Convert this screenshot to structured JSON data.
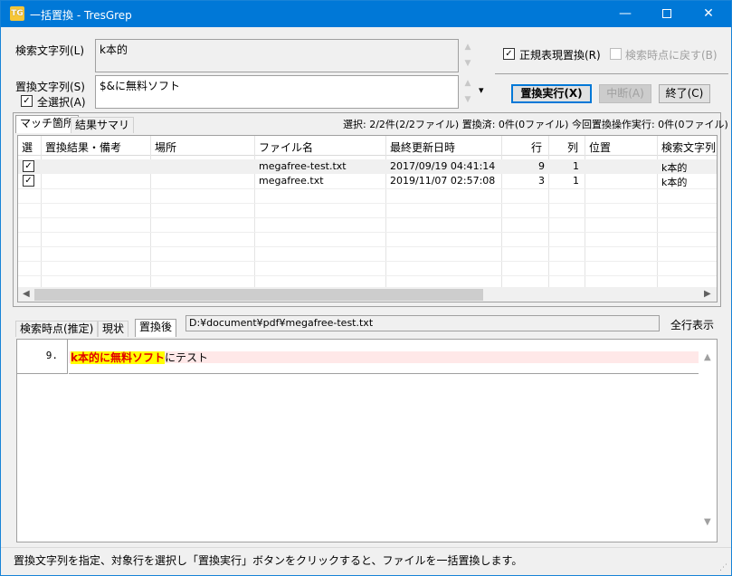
{
  "window": {
    "icon_text": "TG",
    "title": "一括置換 - TresGrep",
    "minimize_glyph": "—",
    "close_glyph": "✕"
  },
  "search": {
    "label": "検索文字列(L)",
    "value": "k本的"
  },
  "replace": {
    "label": "置換文字列(S)",
    "value": "$&に無料ソフト",
    "select_all_label": "全選択(A)",
    "select_all_checked": "✓",
    "dropdown_glyph": "▾"
  },
  "options": {
    "regex_label": "正規表現置換(R)",
    "regex_checked": "✓",
    "restore_label": "検索時点に戻す(B)"
  },
  "buttons": {
    "execute": "置換実行(X)",
    "abort": "中断(A)",
    "close": "終了(C)"
  },
  "result_tabs": [
    "マッチ箇所",
    "結果サマリ"
  ],
  "summary": "選択: 2/2件(2/2ファイル)  置換済: 0件(0ファイル)  今回置換操作実行: 0件(0ファイル)",
  "table": {
    "columns": [
      "選",
      "置換結果・備考",
      "場所",
      "ファイル名",
      "最終更新日時",
      "行",
      "列",
      "位置",
      "検索文字列"
    ],
    "rows": [
      {
        "checked": "✓",
        "note": "",
        "place": "",
        "file": "megafree-test.txt",
        "modified": "2017/09/19 04:41:14",
        "line": "9",
        "col": "1",
        "pos": "",
        "search": "k本的"
      },
      {
        "checked": "✓",
        "note": "",
        "place": "",
        "file": "megafree.txt",
        "modified": "2019/11/07 02:57:08",
        "line": "3",
        "col": "1",
        "pos": "",
        "search": "k本的"
      }
    ]
  },
  "preview_tabs": [
    "検索時点(推定)",
    "現状",
    "置換後"
  ],
  "preview_path": "D:¥document¥pdf¥megafree-test.txt",
  "show_all_lines": "全行表示",
  "preview": {
    "line_number": "9.",
    "highlight": "k本的に無料ソフト",
    "rest": "にテスト"
  },
  "status": "置換文字列を指定、対象行を選択し「置換実行」ボタンをクリックすると、ファイルを一括置換します。"
}
